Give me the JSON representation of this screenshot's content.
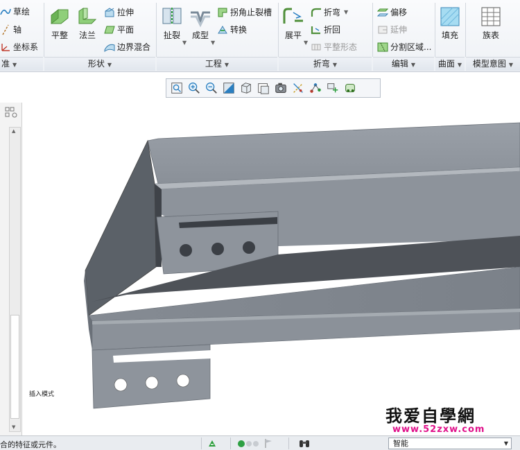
{
  "ribbon": {
    "datum": {
      "sketch_label": "草绘",
      "axis_label": "轴",
      "csys_label": "坐标系",
      "group_label": "准"
    },
    "shapes": {
      "flat_label": "平整",
      "flange_label": "法兰",
      "extrude_label": "拉伸",
      "plane_label": "平面",
      "blend_label": "边界混合",
      "group_label": "形状"
    },
    "engineering": {
      "rip_label": "扯裂",
      "form_label": "成型",
      "corner_relief_label": "拐角止裂槽",
      "convert_label": "转换",
      "group_label": "工程"
    },
    "bends": {
      "unbend_label": "展平",
      "bend_label": "折弯",
      "bend_back_label": "折回",
      "flat_pattern_label": "平整形态",
      "group_label": "折弯"
    },
    "editing": {
      "offset_label": "偏移",
      "extend_label": "延伸",
      "split_area_label": "分割区域...",
      "group_label": "编辑"
    },
    "surfaces": {
      "fill_label": "填充",
      "group_label": "曲面"
    },
    "model_intent": {
      "family_table_label": "族表",
      "group_label": "模型意图"
    }
  },
  "viewport": {
    "mode_label": "插入模式"
  },
  "watermark": {
    "text": "我爱自學網",
    "url": "www.52zxw.com"
  },
  "statusbar": {
    "message": "合的特征或元件。",
    "filter_value": "智能"
  },
  "colors": {
    "ribbon_bg": "#eef1f5",
    "model_face": "#7e848c",
    "model_light": "#9aa0a8",
    "model_dark": "#4a4e54",
    "watermark_pink": "#e0108a"
  }
}
